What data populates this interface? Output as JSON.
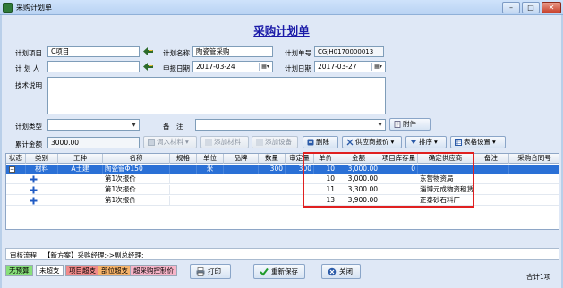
{
  "window": {
    "title": "采购计划单"
  },
  "form": {
    "heading": "采购计划单",
    "project_label": "计划项目",
    "project_value": "C项目",
    "plan_name_label": "计划名称",
    "plan_name_value": "陶瓷管采购",
    "plan_no_label": "计划单号",
    "plan_no_value": "CGJH0170000013",
    "planner_label": "计 划 人",
    "planner_value": "",
    "report_date_label": "申报日期",
    "report_date_value": "2017-03-24",
    "plan_date_label": "计划日期",
    "plan_date_value": "2017-03-27",
    "tech_label": "技术说明",
    "tech_value": "",
    "type_label": "计划类型",
    "type_value": "",
    "remark_label": "备　注",
    "remark_value": "",
    "attach_label": "附件",
    "total_label": "累计金额",
    "total_value": "3000.00"
  },
  "toolbar": {
    "import_label": "调入材料",
    "add_material_label": "添加材料",
    "add_equipment_label": "添加设备",
    "delete_label": "删除",
    "supplier_quote_label": "供应商报价",
    "sort_label": "排序",
    "table_settings_label": "表格设置"
  },
  "grid": {
    "headers": [
      "状态",
      "类别",
      "工种",
      "名称",
      "规格",
      "单位",
      "品牌",
      "数量",
      "审定量",
      "单价",
      "金额",
      "项目库存量",
      "确定供应商",
      "备注",
      "采购合同号"
    ],
    "main_row": {
      "category": "材料",
      "trade": "A土建",
      "name": "陶瓷管Φ150",
      "spec": "",
      "unit": "米",
      "brand": "",
      "qty": "300",
      "approved": "300",
      "price": "10",
      "amount": "3,000.00",
      "stock": "0",
      "supplier": "",
      "remark": "",
      "contract": ""
    },
    "sub_rows": [
      {
        "name": "第1次报价",
        "price": "10",
        "amount": "3,000.00",
        "supplier": "东营物资局"
      },
      {
        "name": "第1次报价",
        "price": "11",
        "amount": "3,300.00",
        "supplier": "淄博元成物资租赁"
      },
      {
        "name": "第1次报价",
        "price": "13",
        "amount": "3,900.00",
        "supplier": "正泰砂石料厂"
      }
    ]
  },
  "audit": {
    "label": "审核流程",
    "flow": "【新方案】采购经理:->副总经理;"
  },
  "legend": {
    "no_budget": "无预算",
    "not_over": "未超支",
    "project_over": "项目超支",
    "dept_over": "部位超支",
    "over_control": "超采购控制价"
  },
  "footer": {
    "print_label": "打印",
    "resave_label": "重新保存",
    "close_label": "关闭",
    "count_text": "合计1项"
  },
  "colors": {
    "title_blue": "#1a1aa8",
    "selection": "#2a70d6",
    "highlight_red": "#e02020",
    "legend_green": "#88e07a",
    "legend_red": "#f08a8a",
    "legend_orange": "#f6b36a",
    "legend_pink": "#f7b4c8"
  },
  "icons": [
    "app-icon",
    "minimize-icon",
    "maximize-icon",
    "close-icon",
    "arrow-left-icon",
    "calendar-icon",
    "paperclip-icon",
    "import-icon",
    "add-icon",
    "delete-icon",
    "quote-icon",
    "sort-icon",
    "table-icon",
    "plus-icon",
    "print-icon",
    "save-icon",
    "close-window-icon"
  ]
}
